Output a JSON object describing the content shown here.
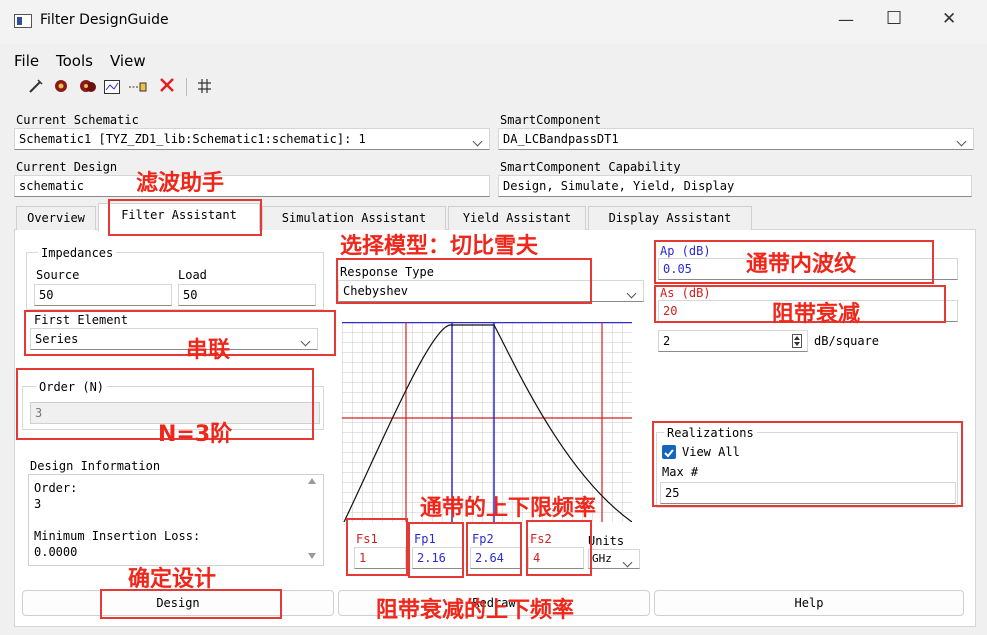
{
  "window": {
    "title": "Filter DesignGuide",
    "minimize": "—",
    "maximize": "☐",
    "close": "✕"
  },
  "menu": [
    "File",
    "Tools",
    "View"
  ],
  "top": {
    "current_schematic_label": "Current Schematic",
    "current_schematic_value": "Schematic1 [TYZ_ZD1_lib:Schematic1:schematic]: 1",
    "smart_component_label": "SmartComponent",
    "smart_component_value": "DA_LCBandpassDT1",
    "current_design_label": "Current Design",
    "current_design_value": "schematic",
    "capability_label": "SmartComponent Capability",
    "capability_value": "Design, Simulate, Yield, Display"
  },
  "tabs": [
    "Overview",
    "Filter Assistant",
    "Simulation Assistant",
    "Yield Assistant",
    "Display Assistant"
  ],
  "impedances": {
    "title": "Impedances",
    "source_label": "Source",
    "load_label": "Load",
    "source_value": "50",
    "load_value": "50"
  },
  "first_element": {
    "label": "First Element",
    "value": "Series"
  },
  "order": {
    "label": "Order (N)",
    "value": "3"
  },
  "design_info": {
    "title": "Design Information",
    "lines": [
      "Order:",
      "3",
      "",
      "Minimum Insertion Loss:",
      "0.0000"
    ]
  },
  "response": {
    "label": "Response Type",
    "value": "Chebyshev"
  },
  "ap": {
    "label": "Ap (dB)",
    "value": "0.05"
  },
  "as": {
    "label": "As (dB)",
    "value": "20"
  },
  "slope": {
    "value": "2",
    "unit": "dB/square"
  },
  "realizations": {
    "title": "Realizations",
    "view_all": "View All",
    "max_label": "Max #",
    "max_value": "25"
  },
  "freqs": {
    "fs1_label": "Fs1",
    "fs1_value": "1",
    "fp1_label": "Fp1",
    "fp1_value": "2.16",
    "fp2_label": "Fp2",
    "fp2_value": "2.64",
    "fs2_label": "Fs2",
    "fs2_value": "4",
    "units_label": "Units",
    "units_value": "GHz"
  },
  "buttons": {
    "design": "Design",
    "redraw": "Redraw",
    "help": "Help"
  },
  "annotations": {
    "lvbo": "滤波助手",
    "model": "选择模型：切比雪夫",
    "ripple": "通带内波纹",
    "stopband": "阻带衰减",
    "series": "串联",
    "order": "N=3阶",
    "passband_limits": "通带的上下限频率",
    "confirm": "确定设计",
    "stop_limits": "阻带衰减的上下频率"
  },
  "colors": {
    "annotation": "#e53935",
    "accent_check": "#1565c0",
    "blue_line": "#2b2bd6",
    "red_line": "#d32020"
  }
}
